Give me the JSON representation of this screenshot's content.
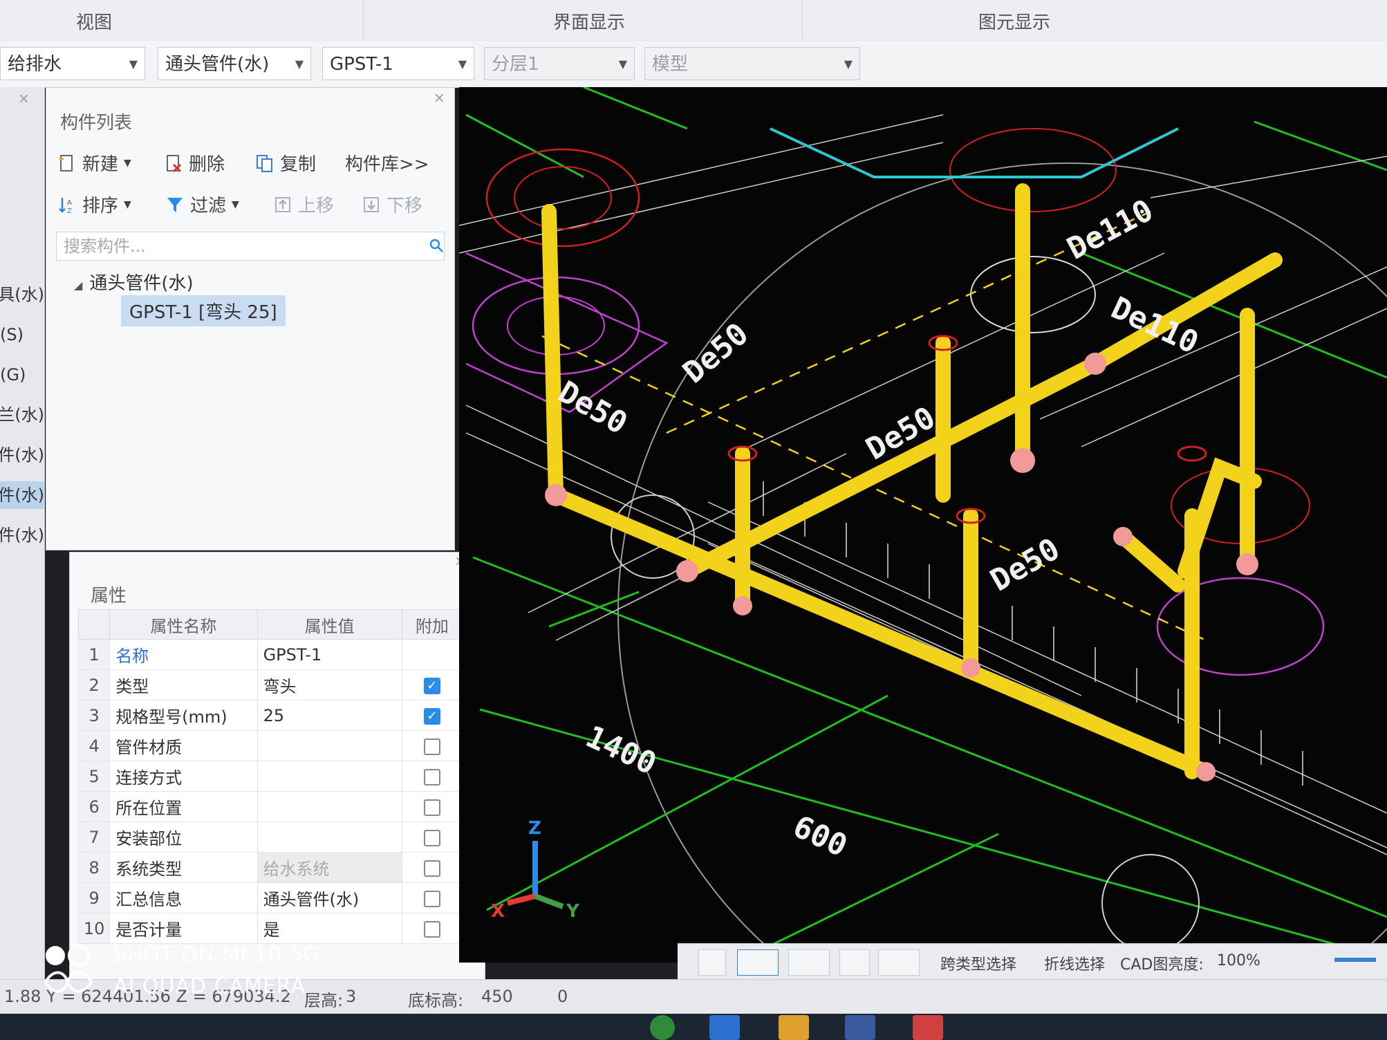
{
  "ribbon": {
    "tab_view": "视图",
    "group_interface": "界面显示",
    "group_elements": "图元显示"
  },
  "toolbar": {
    "combo_system": "给排水",
    "combo_type": "通头管件(水)",
    "combo_component": "GPST-1",
    "combo_layer": "分层1",
    "combo_mode": "模型"
  },
  "left_strip": {
    "items": [
      "具(水)",
      "(S)",
      "(G)",
      "兰(水)",
      "附件(水)",
      "管件(水)",
      "构件(水)"
    ]
  },
  "component_list": {
    "title": "构件列表",
    "btn_new": "新建",
    "btn_delete": "删除",
    "btn_copy": "复制",
    "btn_library": "构件库>>",
    "btn_sort": "排序",
    "btn_filter": "过滤",
    "btn_up": "上移",
    "btn_down": "下移",
    "search_placeholder": "搜索构件...",
    "tree_parent": "通头管件(水)",
    "tree_child": "GPST-1 [弯头 25]"
  },
  "properties": {
    "title": "属性",
    "col_name": "属性名称",
    "col_value": "属性值",
    "col_extra": "附加",
    "rows": [
      {
        "idx": "1",
        "name": "名称",
        "value": "GPST-1"
      },
      {
        "idx": "2",
        "name": "类型",
        "value": "弯头"
      },
      {
        "idx": "3",
        "name": "规格型号(mm)",
        "value": "25"
      },
      {
        "idx": "4",
        "name": "管件材质",
        "value": ""
      },
      {
        "idx": "5",
        "name": "连接方式",
        "value": ""
      },
      {
        "idx": "6",
        "name": "所在位置",
        "value": ""
      },
      {
        "idx": "7",
        "name": "安装部位",
        "value": ""
      },
      {
        "idx": "8",
        "name": "系统类型",
        "value": "给水系统"
      },
      {
        "idx": "9",
        "name": "汇总信息",
        "value": "通头管件(水)"
      },
      {
        "idx": "10",
        "name": "是否计量",
        "value": "是"
      }
    ]
  },
  "viewport": {
    "labels": {
      "de50_a": "De50",
      "de50_b": "De50",
      "de50_c": "De50",
      "de50_d": "De50",
      "de110_a": "De110",
      "de110_b": "De110",
      "dim_1400": "1400",
      "dim_600": "600",
      "axis_z": "Z",
      "axis_y": "Y",
      "axis_x": "X"
    },
    "pipe_color": "#f2d21a",
    "fitting_color": "#f29a9a",
    "line_green": "#1fbf1f",
    "line_magenta": "#c040d0",
    "line_cyan": "#30c8d0",
    "line_red": "#d02020"
  },
  "view_bar": {
    "cross_type_select": "跨类型选择",
    "polyline_select": "折线选择",
    "cad_brightness": "CAD图亮度:",
    "brightness_value": "100%"
  },
  "status": {
    "coords": "1.88 Y = 624401.56 Z = 679034.2",
    "floor_height_label": "层高:",
    "floor_height_value": "3",
    "base_elev_label": "底标高:",
    "base_elev_value": "450",
    "extra_value": "0"
  },
  "watermark": {
    "line1": "SHOT ON MI 10 5G",
    "line2": "AI QUAD CAMERA"
  }
}
